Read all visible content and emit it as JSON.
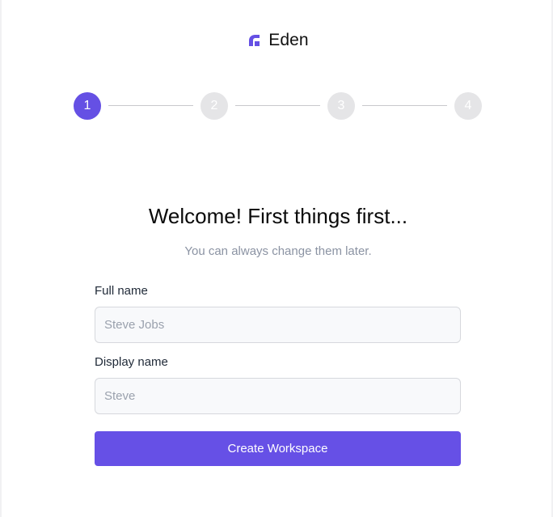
{
  "brand": {
    "name": "Eden",
    "icon": "eden-logo-icon",
    "color": "#6550e4"
  },
  "stepper": {
    "steps": [
      {
        "label": "1",
        "state": "active"
      },
      {
        "label": "2",
        "state": "inactive"
      },
      {
        "label": "3",
        "state": "inactive"
      },
      {
        "label": "4",
        "state": "inactive"
      }
    ],
    "active_color": "#6550e4",
    "inactive_color": "#e5e5e7"
  },
  "main": {
    "title": "Welcome! First things first...",
    "subtitle": "You can always change them later."
  },
  "form": {
    "full_name": {
      "label": "Full name",
      "placeholder": "Steve Jobs",
      "value": ""
    },
    "display_name": {
      "label": "Display name",
      "placeholder": "Steve",
      "value": ""
    },
    "submit_label": "Create Workspace",
    "submit_color": "#6650e6"
  }
}
